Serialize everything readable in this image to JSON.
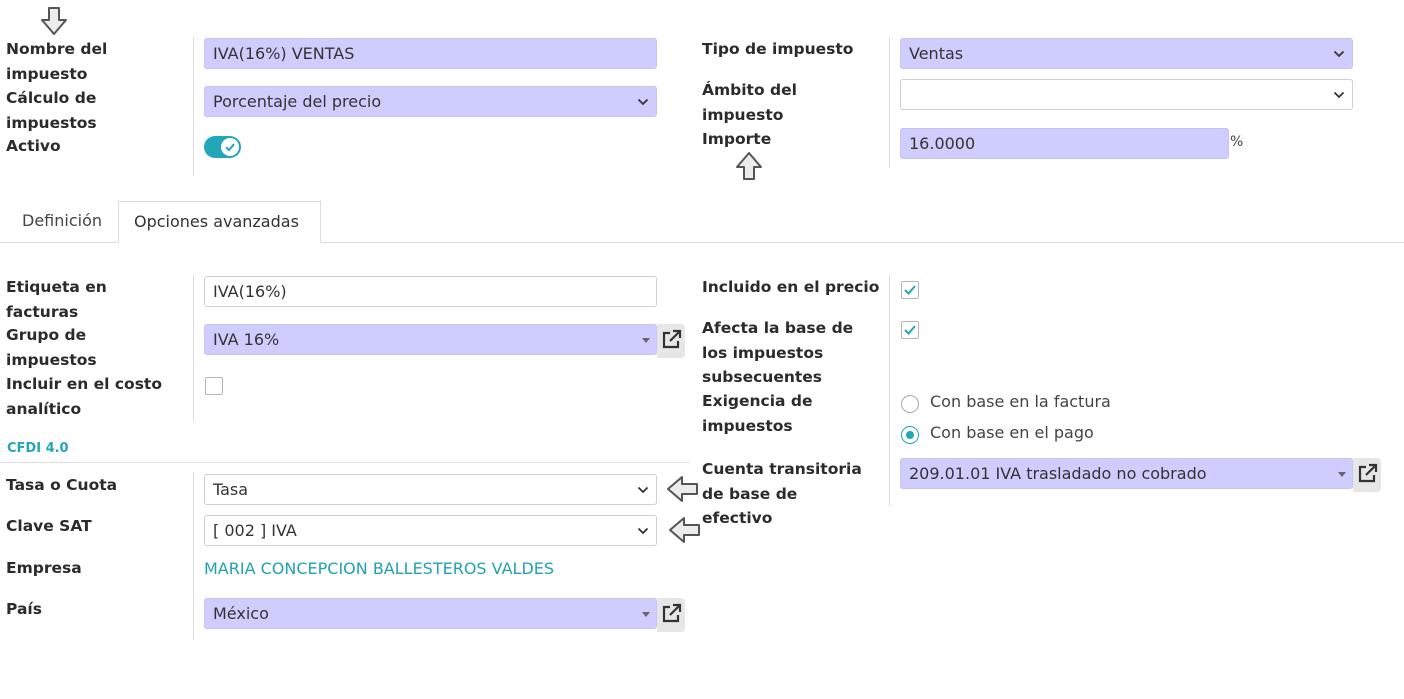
{
  "header": {
    "name_label": "Nombre del impuesto",
    "name_value": "IVA(16%) VENTAS",
    "calc_label": "Cálculo de impuestos",
    "calc_value": "Porcentaje del precio",
    "active_label": "Activo",
    "active_on": true,
    "type_label": "Tipo de impuesto",
    "type_value": "Ventas",
    "scope_label": "Ámbito del impuesto",
    "scope_value": "",
    "amount_label": "Importe",
    "amount_value": "16.0000",
    "amount_unit": "%"
  },
  "tabs": [
    {
      "label": "Definición",
      "active": false
    },
    {
      "label": "Opciones avanzadas",
      "active": true
    }
  ],
  "advanced": {
    "invoice_label_label": "Etiqueta en facturas",
    "invoice_label_value": "IVA(16%)",
    "tax_group_label": "Grupo de impuestos",
    "tax_group_value": "IVA 16%",
    "analytic_label": "Incluir en el costo analítico",
    "analytic_checked": false,
    "price_incl_label": "Incluido en el precio",
    "price_incl_checked": true,
    "affects_base_label": "Afecta la base de los impuestos subsecuentes",
    "affects_base_checked": true,
    "exigibility_label": "Exigencia de impuestos",
    "exigibility_options": [
      "Con base en la factura",
      "Con base en el pago"
    ],
    "exigibility_selected": 1,
    "cash_basis_label": "Cuenta transitoria de base de efectivo",
    "cash_basis_value": "209.01.01 IVA trasladado no cobrado"
  },
  "cfdi": {
    "section_title": "CFDI 4.0",
    "tasa_label": "Tasa o Cuota",
    "tasa_value": "Tasa",
    "clave_label": "Clave SAT",
    "clave_value": "[ 002 ] IVA",
    "empresa_label": "Empresa",
    "empresa_value": "MARIA CONCEPCION BALLESTEROS VALDES",
    "pais_label": "País",
    "pais_value": "México"
  },
  "colors": {
    "accent": "#22a7b8",
    "required_bg": "#cfcdfd",
    "link": "#1fa3b3"
  },
  "icons": [
    "down-arrow-icon",
    "up-arrow-icon",
    "left-arrow-icon",
    "chevron-down-icon",
    "caret-down-icon",
    "external-link-icon",
    "checkmark-icon"
  ]
}
